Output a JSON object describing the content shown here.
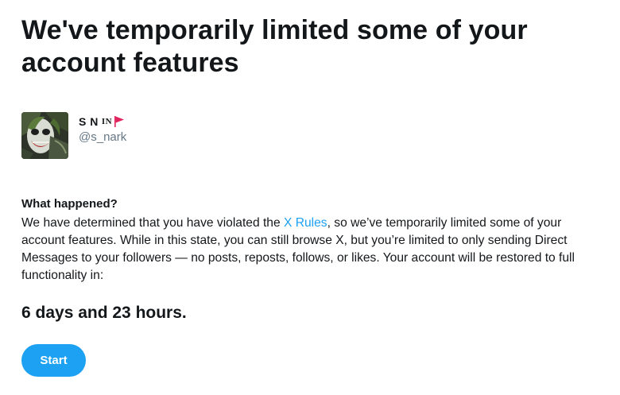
{
  "header": {
    "title": "We've temporarily limited some of your account features"
  },
  "profile": {
    "display_name": "S N",
    "tag": "IN",
    "flag_icon": "red-flag-icon",
    "flag_color": "#e0245e",
    "handle": "@s_nark",
    "avatar_icon": "joker-avatar"
  },
  "notice": {
    "heading": "What happened?",
    "text_before_link": "We have determined that you have violated the ",
    "link_text": "X Rules",
    "text_after_link": ", so we’ve temporarily limited some of your account features. While in this state, you can still browse X, but you’re limited to only sending Direct Messages to your followers — no posts, reposts, follows, or likes. Your account will be restored to full functionality in:",
    "countdown": "6 days and 23 hours."
  },
  "actions": {
    "start_label": "Start"
  },
  "colors": {
    "accent": "#1da1f2",
    "text": "#14171a",
    "secondary_text": "#657786"
  }
}
